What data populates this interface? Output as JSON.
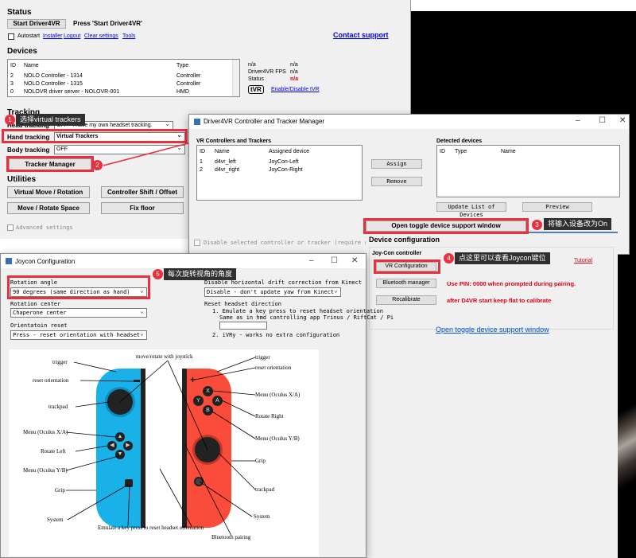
{
  "main": {
    "status_title": "Status",
    "start_button": "Start Driver4VR",
    "start_hint": "Press 'Start Driver4VR'",
    "autostart": "Autostart",
    "links": [
      "Installer",
      "Logout",
      "Clear settings",
      "Tools"
    ],
    "contact": "Contact support",
    "devices_title": "Devices",
    "devices_headers": [
      "ID",
      "Name",
      "Type"
    ],
    "devices": [
      {
        "id": "2",
        "name": "NOLO Controller - 1314",
        "type": "Controller"
      },
      {
        "id": "3",
        "name": "NOLO Controller - 1315",
        "type": "Controller"
      },
      {
        "id": "0",
        "name": "NOLOVR driver server - NOLOVR-001",
        "type": "HMD"
      }
    ],
    "stats": [
      {
        "label": "n/a",
        "value": "n/a"
      },
      {
        "label": "Driver4VR FPS",
        "value": "n/a"
      },
      {
        "label": "Status",
        "value": "n/a"
      }
    ],
    "tvr_logo": "tVR",
    "tvr_link": "Enable/Disable tVR",
    "tracking_title": "Tracking",
    "head_tracking_label": "Head tracking",
    "head_tracking_value": "OFF - I have my own headset tracking.",
    "hand_tracking_label": "Hand tracking",
    "hand_tracking_value": "Virtual Trackers",
    "body_tracking_label": "Body tracking",
    "body_tracking_value": "OFF",
    "tracker_manager": "Tracker Manager",
    "utilities_title": "Utilities",
    "util_buttons": [
      "Virtual Move / Rotation",
      "Controller Shift / Offset",
      "Move / Rotate Space",
      "Fix floor"
    ],
    "advanced": "Advanced settings"
  },
  "manager": {
    "title": "Driver4VR Controller and Tracker Manager",
    "vr_title": "VR Controllers and Trackers",
    "vr_headers": [
      "ID",
      "Name",
      "Assigned device"
    ],
    "vr_rows": [
      {
        "id": "1",
        "name": "d4vr_left",
        "device": "JoyCon-Left"
      },
      {
        "id": "2",
        "name": "d4vr_right",
        "device": "JoyCon-Right"
      }
    ],
    "assign": "Assign",
    "remove": "Remove",
    "detected_title": "Detected devices",
    "detected_headers": [
      "ID",
      "Type",
      "Name"
    ],
    "update_list": "Update List of Devices",
    "preview": "Preview",
    "open_toggle": "Open toggle device support window",
    "disable_text": "Disable selected controller or tracker (require restart c",
    "device_config": "Device configuration",
    "joycon_controller": "Joy-Con controller",
    "vr_config": "VR Configuration",
    "tutorial": "Tutorial",
    "bluetooth": "Bluetooth manager",
    "pin_text": "Use PIN: 0000 when prompted during pairing.",
    "recalibrate": "Recalibrate",
    "calib_text": "after D4VR start keep flat to calibrate",
    "open_toggle_link": "Open toggle device support window"
  },
  "joycon": {
    "title": "Joycon Configuration",
    "rotation_angle_label": "Rotation angle",
    "rotation_angle_value": "90 degrees (same direction as hand)",
    "rotation_center_label": "Rotation center",
    "rotation_center_value": "Chaperone center",
    "orientation_reset_label": "Orientatoin reset",
    "orientation_reset_value": "Press - reset orientation with headset",
    "drift_label": "Disable horizontal drift correction from Kinect",
    "drift_value": "Disable - don't update yaw from Kinect",
    "reset_dir_label": "Reset headset direction",
    "reset_dir_1a": "1. Emulate a key press to reset headset orientation",
    "reset_dir_1b": "Same as in hmd controlling app Trinus / RiftCat / Pi",
    "reset_dir_2": "2. iVRy - works no extra configuration"
  },
  "diagram": {
    "left": [
      "trigger",
      "reset orientation",
      "trackpad",
      "Menu (Oculus X/A)",
      "Rotate Left",
      "Menu (Oculus Y/B)",
      "Grip",
      "System"
    ],
    "top": "move/rotate with joystick",
    "right": [
      "trigger",
      "reset orientation",
      "Menu (Oculus X/A)",
      "Rotate Right",
      "Menu (Oculus Y/B)",
      "Grip",
      "trackpad",
      "System"
    ],
    "bottom1": "Emulate a key press to reset headset orientation",
    "bottom2": "Bluetooth pairing",
    "btn_x": "X",
    "btn_a": "A",
    "btn_y": "Y",
    "btn_b": "B"
  },
  "annotations": [
    {
      "num": "1",
      "text": "选择virtual trackers"
    },
    {
      "num": "2",
      "text": ""
    },
    {
      "num": "3",
      "text": "将输入设备改为On"
    },
    {
      "num": "4",
      "text": "点这里可以查看Joycon键位"
    },
    {
      "num": "5",
      "text": "每次旋转视角的角度"
    }
  ],
  "colors": {
    "annotation": "#e8313f",
    "callout": "#303030",
    "joycon_blue": "#1ab0e8",
    "joycon_red": "#fa4c3a",
    "link": "#0000ee"
  }
}
